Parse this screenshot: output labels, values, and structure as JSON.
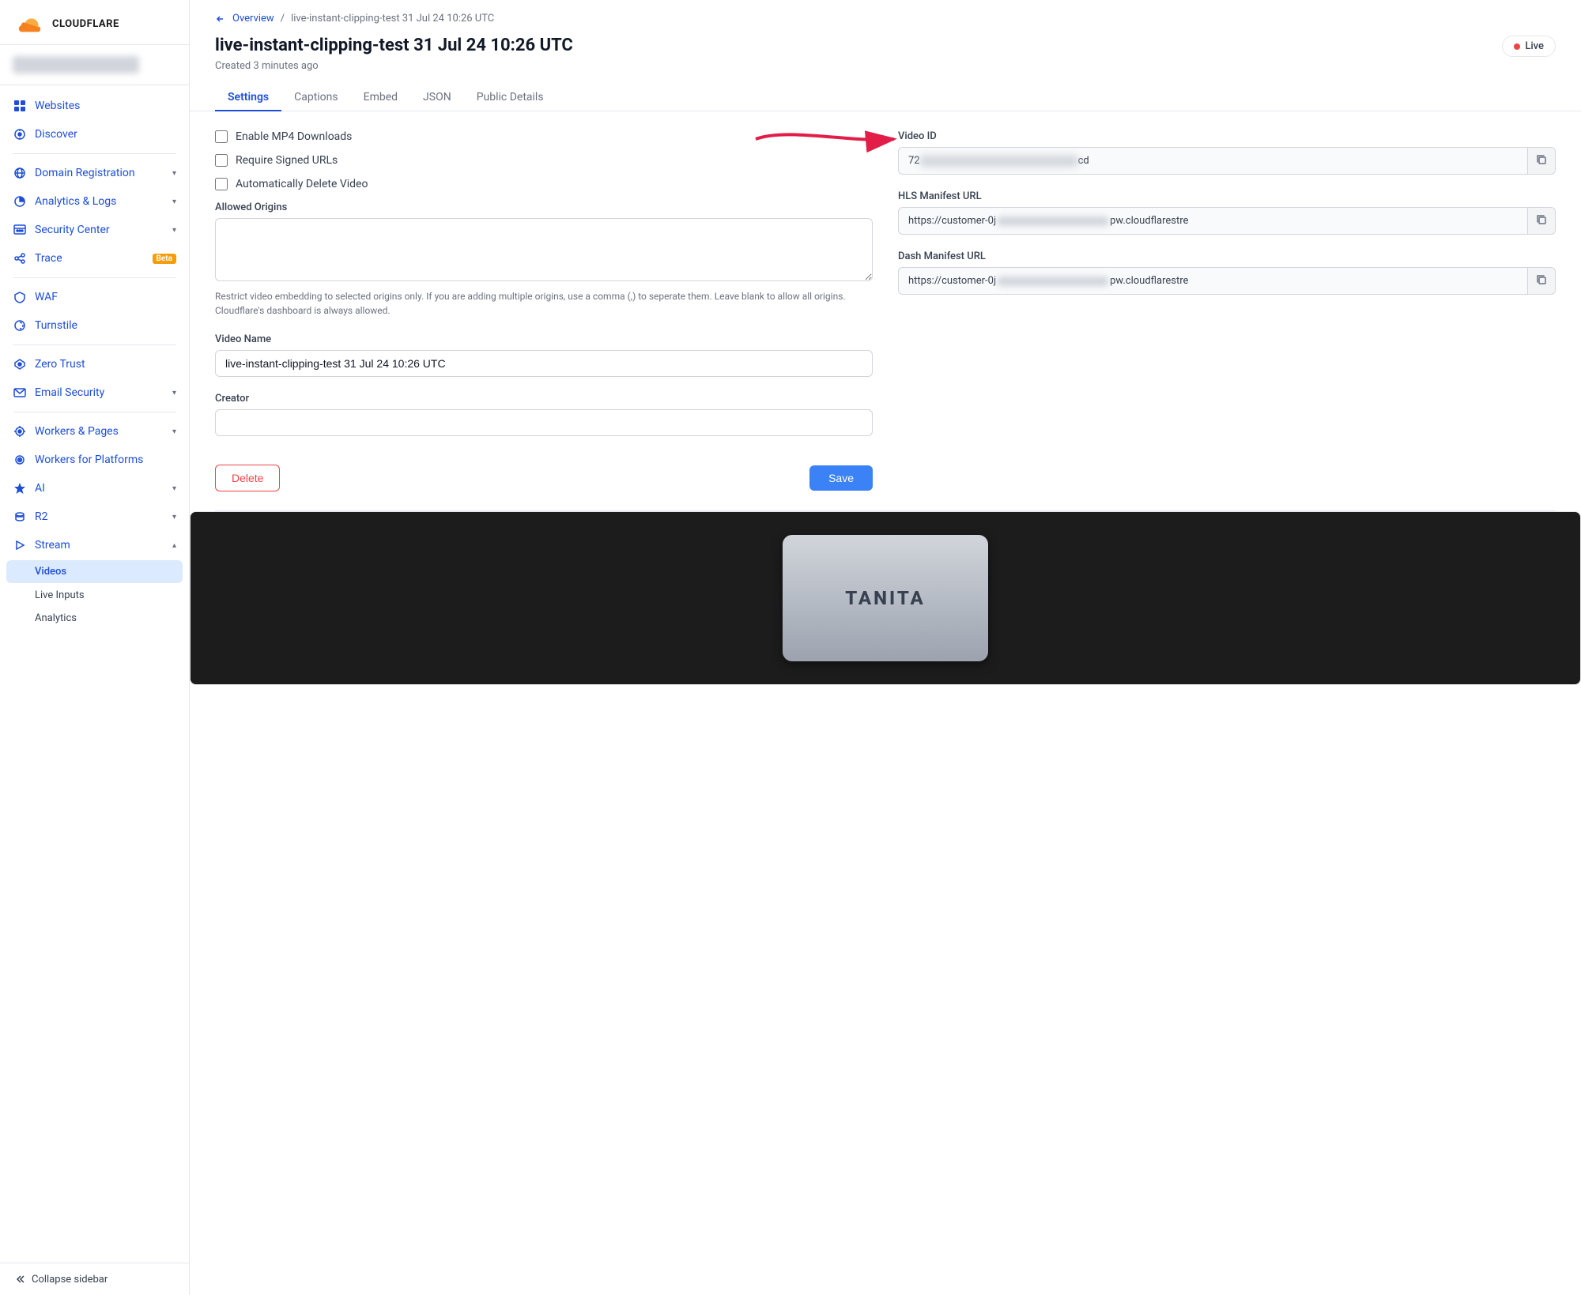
{
  "sidebar": {
    "logo_text": "CLOUDFLARE",
    "nav_items": [
      {
        "id": "websites",
        "label": "Websites",
        "icon": "□",
        "has_chevron": false
      },
      {
        "id": "discover",
        "label": "Discover",
        "icon": "☀",
        "has_chevron": false
      },
      {
        "id": "domain-registration",
        "label": "Domain Registration",
        "icon": "🌐",
        "has_chevron": true
      },
      {
        "id": "analytics-logs",
        "label": "Analytics & Logs",
        "icon": "◔",
        "has_chevron": true
      },
      {
        "id": "security-center",
        "label": "Security Center",
        "icon": "🖥",
        "has_chevron": true
      },
      {
        "id": "trace",
        "label": "Trace",
        "icon": "⋈",
        "has_chevron": false,
        "badge": "Beta"
      },
      {
        "id": "waf",
        "label": "WAF",
        "icon": "⊕",
        "has_chevron": false
      },
      {
        "id": "turnstile",
        "label": "Turnstile",
        "icon": "↻",
        "has_chevron": false
      },
      {
        "id": "zero-trust",
        "label": "Zero Trust",
        "icon": "◈",
        "has_chevron": false
      },
      {
        "id": "email-security",
        "label": "Email Security",
        "icon": "✉",
        "has_chevron": true
      },
      {
        "id": "workers-pages",
        "label": "Workers & Pages",
        "icon": "⊙",
        "has_chevron": true
      },
      {
        "id": "workers-platforms",
        "label": "Workers for Platforms",
        "icon": "◉",
        "has_chevron": false
      },
      {
        "id": "ai",
        "label": "AI",
        "icon": "✦",
        "has_chevron": true
      },
      {
        "id": "r2",
        "label": "R2",
        "icon": "⊚",
        "has_chevron": true
      },
      {
        "id": "stream",
        "label": "Stream",
        "icon": "⊿",
        "has_chevron": true,
        "expanded": true
      }
    ],
    "stream_sub_items": [
      {
        "id": "videos",
        "label": "Videos",
        "active": true
      },
      {
        "id": "live-inputs",
        "label": "Live Inputs"
      },
      {
        "id": "analytics",
        "label": "Analytics"
      }
    ],
    "collapse_label": "Collapse sidebar"
  },
  "breadcrumb": {
    "back_label": "Overview",
    "separator": "/",
    "current": "live-instant-clipping-test 31 Jul 24 10:26 UTC"
  },
  "page": {
    "title": "live-instant-clipping-test 31 Jul 24 10:26 UTC",
    "created_text": "Created 3 minutes ago",
    "live_badge": "Live"
  },
  "tabs": [
    {
      "id": "settings",
      "label": "Settings",
      "active": true
    },
    {
      "id": "captions",
      "label": "Captions"
    },
    {
      "id": "embed",
      "label": "Embed"
    },
    {
      "id": "json",
      "label": "JSON"
    },
    {
      "id": "public-details",
      "label": "Public Details"
    }
  ],
  "settings": {
    "enable_mp4_label": "Enable MP4 Downloads",
    "require_signed_label": "Require Signed URLs",
    "auto_delete_label": "Automatically Delete Video",
    "allowed_origins_label": "Allowed Origins",
    "allowed_origins_help": "Restrict video embedding to selected origins only. If you are adding multiple origins, use a comma (,) to seperate them. Leave blank to allow all origins. Cloudflare's dashboard is always allowed.",
    "video_name_label": "Video Name",
    "video_name_value": "live-instant-clipping-test 31 Jul 24 10:26 UTC",
    "creator_label": "Creator",
    "creator_value": "",
    "delete_label": "Delete",
    "save_label": "Save"
  },
  "right_panel": {
    "video_id_label": "Video ID",
    "video_id_prefix": "72",
    "video_id_suffix": "cd",
    "hls_label": "HLS Manifest URL",
    "hls_prefix": "https://customer-0j",
    "hls_suffix": "pw.cloudflarestre",
    "dash_label": "Dash Manifest URL",
    "dash_prefix": "https://customer-0j",
    "dash_suffix": "pw.cloudflarestre"
  },
  "video_preview": {
    "brand_text": "TANITA"
  }
}
